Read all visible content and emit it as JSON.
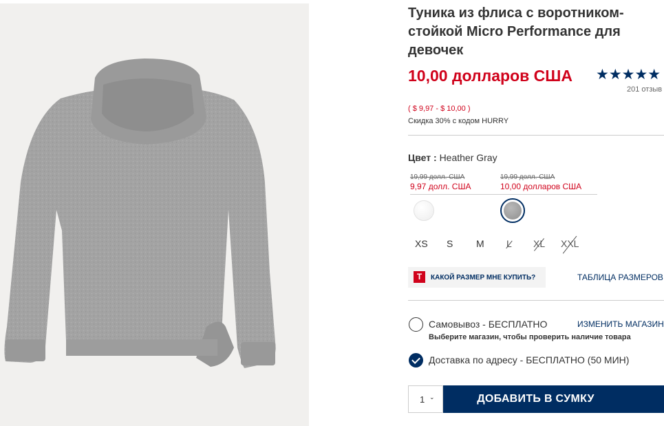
{
  "product": {
    "title": "Туника из флиса с воротником-стойкой Micro Performance для девочек",
    "price": "10,00 долларов США",
    "price_range": "( $ 9,97 - $ 10,00 )",
    "discount": "Скидка 30% с кодом HURRY",
    "rating_stars": "★★★★★",
    "rating_value": 4.5,
    "reviews": "201 отзыв"
  },
  "color": {
    "label": "Цвет :",
    "selected": "Heather Gray",
    "variants": [
      {
        "old_price": "19,99 долл. США",
        "new_price": "9,97 долл. США",
        "swatch": "#f4f4f4"
      },
      {
        "old_price": "19,99 долл. США",
        "new_price": "10,00 долларов США",
        "swatch": "#9e9e9e"
      }
    ]
  },
  "sizes": [
    {
      "label": "XS",
      "available": true
    },
    {
      "label": "S",
      "available": true
    },
    {
      "label": "M",
      "available": true
    },
    {
      "label": "L",
      "available": false
    },
    {
      "label": "XL",
      "available": false
    },
    {
      "label": "XXL",
      "available": false
    }
  ],
  "fit": {
    "icon_letter": "T",
    "label": "КАКОЙ РАЗМЕР МНЕ КУПИТЬ?",
    "size_chart": "ТАБЛИЦА РАЗМЕРОВ"
  },
  "fulfillment": {
    "pickup_label": "Самовывоз - БЕСПЛАТНО",
    "pickup_sub": "Выберите магазин, чтобы проверить наличие товара",
    "change_store": "ИЗМЕНИТЬ МАГАЗИН",
    "delivery_label": "Доставка по адресу - БЕСПЛАТНО (50 МИН)"
  },
  "cart": {
    "quantity": "1",
    "add_label": "ДОБАВИТЬ В СУМКУ"
  },
  "colors": {
    "brand_navy": "#002d62",
    "sale_red": "#d0021b"
  }
}
